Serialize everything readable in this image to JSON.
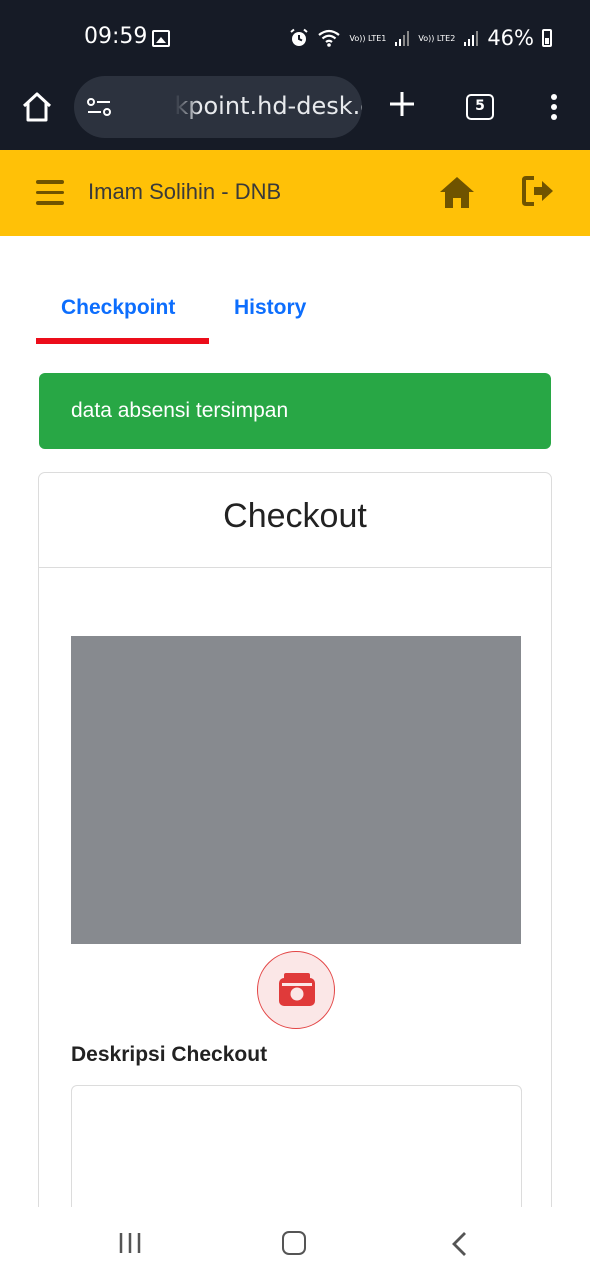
{
  "status_bar": {
    "time": "09:59",
    "battery": "46%",
    "sim1": "Vo)) LTE1",
    "sim2": "Vo)) LTE2",
    "icons": [
      "image-icon",
      "alarm-icon",
      "wifi-icon",
      "signal-icon",
      "battery-icon"
    ]
  },
  "browser": {
    "url": "checkpoint.hd-desk.com",
    "tab_count": "5",
    "icons": [
      "home-icon",
      "site-settings-icon",
      "plus-icon",
      "tabs-icon",
      "menu-icon"
    ]
  },
  "header": {
    "title": "Imam Solihin - DNB",
    "background": "#ffc107",
    "icons": [
      "hamburger-icon",
      "home-icon",
      "logout-icon"
    ]
  },
  "tabs": [
    {
      "label": "Checkpoint",
      "active": true
    },
    {
      "label": "History",
      "active": false
    }
  ],
  "alert": {
    "message": "data absensi tersimpan",
    "color": "#28a745"
  },
  "card": {
    "title": "Checkout",
    "description_label": "Deskripsi Checkout",
    "description_value": "",
    "capture_icon": "camera-icon"
  },
  "nav_bar": {
    "icons": [
      "recents-icon",
      "home-icon",
      "back-icon"
    ]
  }
}
